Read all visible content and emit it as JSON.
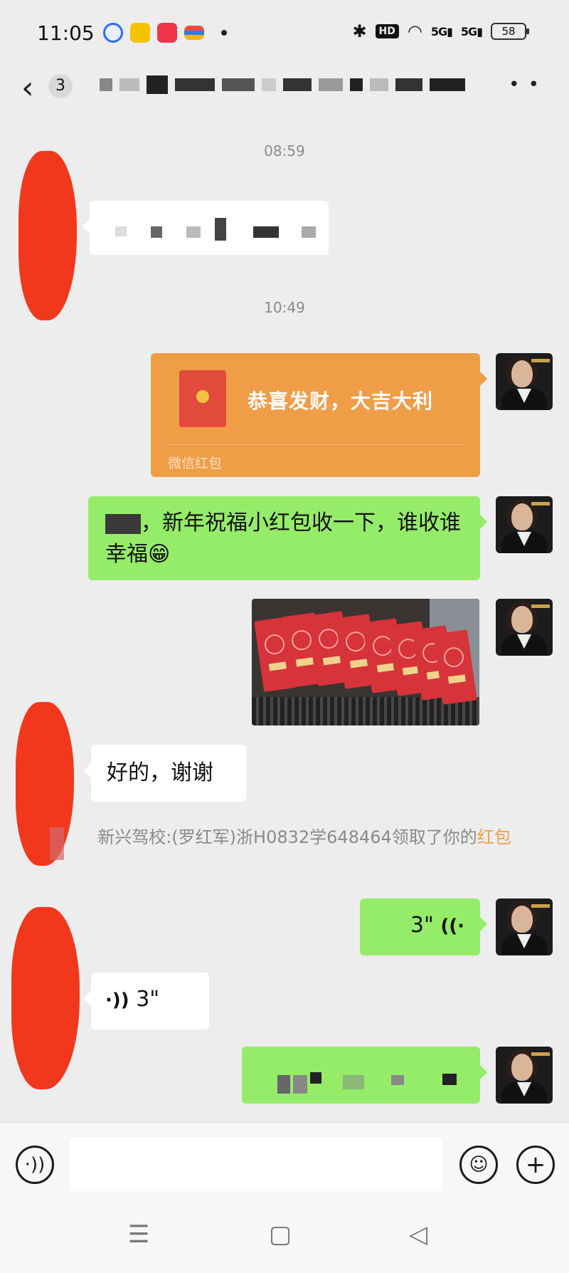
{
  "status_bar": {
    "time": "11:05",
    "hd": "HD",
    "signal1": "5G",
    "signal2": "5G",
    "battery": "58"
  },
  "nav": {
    "unread_count": "3"
  },
  "messages": {
    "time1": "08:59",
    "time2": "10:49",
    "hongbao_title": "恭喜发财，大吉大利",
    "hongbao_footer": "微信红包",
    "greeting_text": "，新年祝福小红包收一下，谁收谁幸福😁",
    "reply_text": "好的，谢谢",
    "system_prefix": "新兴驾校:(罗红军)浙H0832学648464领取了你的",
    "system_link": "红包",
    "voice_out_duration": "3\"",
    "voice_in_duration": "3\""
  },
  "icons": {
    "back": "chevron-left-icon",
    "more": "more-icon",
    "voice_toggle": "voice-input-icon",
    "emoji": "emoji-icon",
    "add": "plus-icon"
  },
  "colors": {
    "outgoing_bubble": "#95ec69",
    "incoming_bubble": "#ffffff",
    "hongbao": "#f09d48",
    "background": "#ededed"
  }
}
